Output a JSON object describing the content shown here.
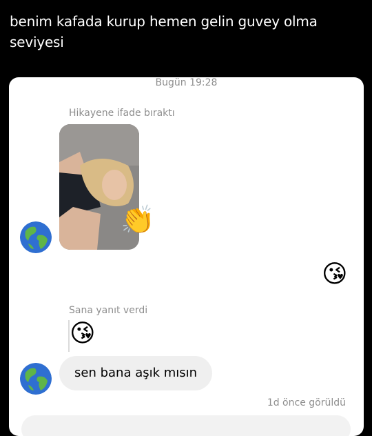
{
  "tweet": {
    "text": "benim kafada kurup hemen gelin guvey olma seviyesi"
  },
  "chat": {
    "timestamp": "Bugün 19:28",
    "story_reaction_caption": "Hikayene ifade bıraktı",
    "story_reaction_emoji": "👏",
    "sent_emoji": "😘",
    "reply_caption": "Sana yanıt verdi",
    "quoted_emoji": "😘",
    "message": "sen bana aşık mısın",
    "seen_status": "1d önce görüldü"
  },
  "icons": {
    "avatar": "globe-icon",
    "clap": "clapping-hands-icon",
    "kiss": "face-blowing-kiss-icon"
  }
}
